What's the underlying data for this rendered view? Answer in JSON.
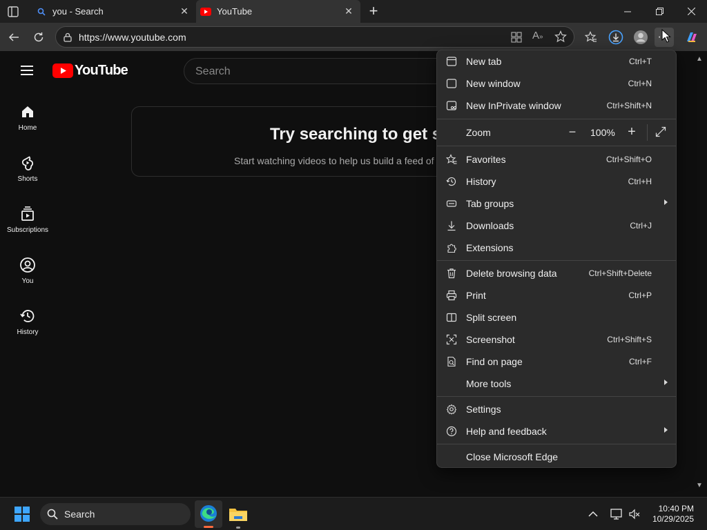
{
  "browser": {
    "tabs": [
      {
        "title": "you - Search"
      },
      {
        "title": "YouTube"
      }
    ],
    "url": "https://www.youtube.com"
  },
  "youtube": {
    "logo_text": "YouTube",
    "search_placeholder": "Search",
    "sidebar": [
      {
        "label": "Home",
        "icon": "home-icon"
      },
      {
        "label": "Shorts",
        "icon": "shorts-icon"
      },
      {
        "label": "Subscriptions",
        "icon": "subscriptions-icon"
      },
      {
        "label": "You",
        "icon": "you-icon"
      },
      {
        "label": "History",
        "icon": "history-icon"
      }
    ],
    "promo": {
      "title": "Try searching to get st",
      "subtitle": "Start watching videos to help us build a feed of"
    }
  },
  "menu": {
    "items": [
      {
        "label": "New tab",
        "shortcut": "Ctrl+T",
        "icon": "new-tab-icon"
      },
      {
        "label": "New window",
        "shortcut": "Ctrl+N",
        "icon": "new-window-icon"
      },
      {
        "label": "New InPrivate window",
        "shortcut": "Ctrl+Shift+N",
        "icon": "inprivate-icon"
      },
      {
        "label": "Favorites",
        "shortcut": "Ctrl+Shift+O",
        "icon": "favorites-icon"
      },
      {
        "label": "History",
        "shortcut": "Ctrl+H",
        "icon": "history-icon"
      },
      {
        "label": "Tab groups",
        "shortcut": "",
        "icon": "tab-groups-icon"
      },
      {
        "label": "Downloads",
        "shortcut": "Ctrl+J",
        "icon": "downloads-icon"
      },
      {
        "label": "Extensions",
        "shortcut": "",
        "icon": "extensions-icon"
      },
      {
        "label": "Delete browsing data",
        "shortcut": "Ctrl+Shift+Delete",
        "icon": "delete-icon"
      },
      {
        "label": "Print",
        "shortcut": "Ctrl+P",
        "icon": "print-icon"
      },
      {
        "label": "Split screen",
        "shortcut": "",
        "icon": "split-screen-icon"
      },
      {
        "label": "Screenshot",
        "shortcut": "Ctrl+Shift+S",
        "icon": "screenshot-icon"
      },
      {
        "label": "Find on page",
        "shortcut": "Ctrl+F",
        "icon": "find-icon"
      },
      {
        "label": "More tools",
        "shortcut": "",
        "icon": ""
      },
      {
        "label": "Settings",
        "shortcut": "",
        "icon": "settings-icon"
      },
      {
        "label": "Help and feedback",
        "shortcut": "",
        "icon": "help-icon"
      },
      {
        "label": "Close Microsoft Edge",
        "shortcut": "",
        "icon": ""
      }
    ],
    "zoom": {
      "label": "Zoom",
      "value": "100%"
    }
  },
  "taskbar": {
    "search_label": "Search",
    "time": "10:40 PM",
    "date": "10/29/2025"
  },
  "colors": {
    "youtube_red": "#ff0000",
    "download_accent": "#4aa3ff",
    "menu_bg": "#2b2b2b"
  }
}
